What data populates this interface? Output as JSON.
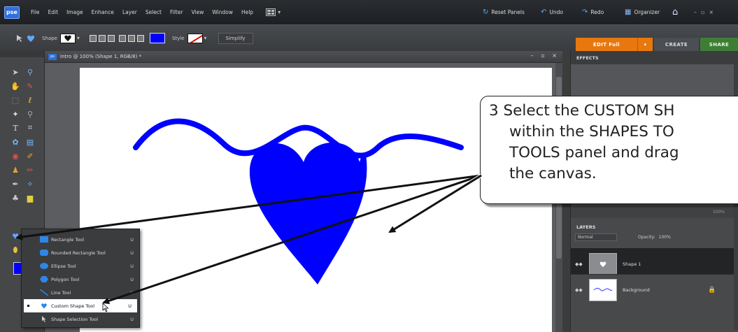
{
  "menubar": {
    "logo": "pse",
    "items": [
      "File",
      "Edit",
      "Image",
      "Enhance",
      "Layer",
      "Select",
      "Filter",
      "View",
      "Window",
      "Help"
    ],
    "reset_panels": "Reset Panels",
    "undo": "Undo",
    "redo": "Redo",
    "organizer": "Organizer",
    "window_controls": "– ▫ ×"
  },
  "options": {
    "shape_label": "Shape",
    "style_label": "Style",
    "simplify_label": "Simplify",
    "shape_color": "#0000ff"
  },
  "mode_tabs": {
    "edit": "EDIT Full",
    "create": "CREATE",
    "share": "SHARE"
  },
  "document": {
    "title": "Intro @ 100% (Shape 1, RGB/8) *",
    "icon": "ps",
    "controls": "– ▫ ×"
  },
  "flyout": {
    "items": [
      {
        "label": "Rectangle Tool",
        "key": "U",
        "icon": "rectangle-icon"
      },
      {
        "label": "Rounded Rectangle Tool",
        "key": "U",
        "icon": "rounded-rectangle-icon"
      },
      {
        "label": "Ellipse Tool",
        "key": "U",
        "icon": "ellipse-icon"
      },
      {
        "label": "Polygon Tool",
        "key": "U",
        "icon": "polygon-icon"
      },
      {
        "label": "Line Tool",
        "key": "U",
        "icon": "line-icon"
      },
      {
        "label": "Custom Shape Tool",
        "key": "U",
        "icon": "heart-icon",
        "selected": true
      },
      {
        "label": "Shape Selection Tool",
        "key": "U",
        "icon": "arrow-icon"
      }
    ]
  },
  "panels": {
    "effects_title": "EFFECTS",
    "effects_status": "100%",
    "layers_title": "LAYERS",
    "blend_mode": "Normal",
    "opacity_label": "Opacity:",
    "opacity_value": "100%",
    "layers": [
      {
        "name": "Shape 1",
        "selected": true
      },
      {
        "name": "Background",
        "locked": true
      }
    ]
  },
  "callout": {
    "line1": "3 Select the CUSTOM SH",
    "line2": "within the SHAPES TO",
    "line3": "TOOLS panel and drag",
    "line4": "the canvas."
  },
  "colors": {
    "foreground": "#0000ff",
    "background": "#ffffff",
    "accent_edit": "#e8780e",
    "accent_share": "#3f7d37"
  }
}
